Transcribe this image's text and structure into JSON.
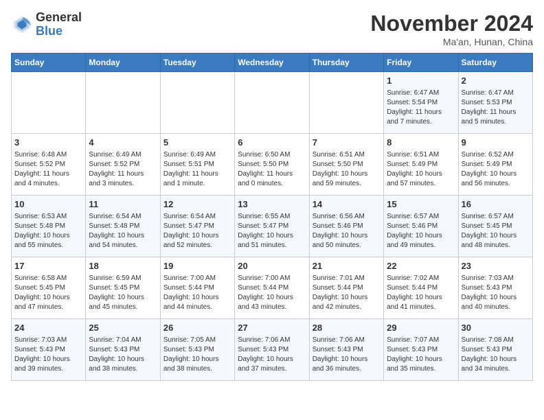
{
  "header": {
    "logo": {
      "line1": "General",
      "line2": "Blue"
    },
    "title": "November 2024",
    "location": "Ma'an, Hunan, China"
  },
  "days_of_week": [
    "Sunday",
    "Monday",
    "Tuesday",
    "Wednesday",
    "Thursday",
    "Friday",
    "Saturday"
  ],
  "weeks": [
    [
      {
        "day": "",
        "info": ""
      },
      {
        "day": "",
        "info": ""
      },
      {
        "day": "",
        "info": ""
      },
      {
        "day": "",
        "info": ""
      },
      {
        "day": "",
        "info": ""
      },
      {
        "day": "1",
        "info": "Sunrise: 6:47 AM\nSunset: 5:54 PM\nDaylight: 11 hours\nand 7 minutes."
      },
      {
        "day": "2",
        "info": "Sunrise: 6:47 AM\nSunset: 5:53 PM\nDaylight: 11 hours\nand 5 minutes."
      }
    ],
    [
      {
        "day": "3",
        "info": "Sunrise: 6:48 AM\nSunset: 5:52 PM\nDaylight: 11 hours\nand 4 minutes."
      },
      {
        "day": "4",
        "info": "Sunrise: 6:49 AM\nSunset: 5:52 PM\nDaylight: 11 hours\nand 3 minutes."
      },
      {
        "day": "5",
        "info": "Sunrise: 6:49 AM\nSunset: 5:51 PM\nDaylight: 11 hours\nand 1 minute."
      },
      {
        "day": "6",
        "info": "Sunrise: 6:50 AM\nSunset: 5:50 PM\nDaylight: 11 hours\nand 0 minutes."
      },
      {
        "day": "7",
        "info": "Sunrise: 6:51 AM\nSunset: 5:50 PM\nDaylight: 10 hours\nand 59 minutes."
      },
      {
        "day": "8",
        "info": "Sunrise: 6:51 AM\nSunset: 5:49 PM\nDaylight: 10 hours\nand 57 minutes."
      },
      {
        "day": "9",
        "info": "Sunrise: 6:52 AM\nSunset: 5:49 PM\nDaylight: 10 hours\nand 56 minutes."
      }
    ],
    [
      {
        "day": "10",
        "info": "Sunrise: 6:53 AM\nSunset: 5:48 PM\nDaylight: 10 hours\nand 55 minutes."
      },
      {
        "day": "11",
        "info": "Sunrise: 6:54 AM\nSunset: 5:48 PM\nDaylight: 10 hours\nand 54 minutes."
      },
      {
        "day": "12",
        "info": "Sunrise: 6:54 AM\nSunset: 5:47 PM\nDaylight: 10 hours\nand 52 minutes."
      },
      {
        "day": "13",
        "info": "Sunrise: 6:55 AM\nSunset: 5:47 PM\nDaylight: 10 hours\nand 51 minutes."
      },
      {
        "day": "14",
        "info": "Sunrise: 6:56 AM\nSunset: 5:46 PM\nDaylight: 10 hours\nand 50 minutes."
      },
      {
        "day": "15",
        "info": "Sunrise: 6:57 AM\nSunset: 5:46 PM\nDaylight: 10 hours\nand 49 minutes."
      },
      {
        "day": "16",
        "info": "Sunrise: 6:57 AM\nSunset: 5:45 PM\nDaylight: 10 hours\nand 48 minutes."
      }
    ],
    [
      {
        "day": "17",
        "info": "Sunrise: 6:58 AM\nSunset: 5:45 PM\nDaylight: 10 hours\nand 47 minutes."
      },
      {
        "day": "18",
        "info": "Sunrise: 6:59 AM\nSunset: 5:45 PM\nDaylight: 10 hours\nand 45 minutes."
      },
      {
        "day": "19",
        "info": "Sunrise: 7:00 AM\nSunset: 5:44 PM\nDaylight: 10 hours\nand 44 minutes."
      },
      {
        "day": "20",
        "info": "Sunrise: 7:00 AM\nSunset: 5:44 PM\nDaylight: 10 hours\nand 43 minutes."
      },
      {
        "day": "21",
        "info": "Sunrise: 7:01 AM\nSunset: 5:44 PM\nDaylight: 10 hours\nand 42 minutes."
      },
      {
        "day": "22",
        "info": "Sunrise: 7:02 AM\nSunset: 5:44 PM\nDaylight: 10 hours\nand 41 minutes."
      },
      {
        "day": "23",
        "info": "Sunrise: 7:03 AM\nSunset: 5:43 PM\nDaylight: 10 hours\nand 40 minutes."
      }
    ],
    [
      {
        "day": "24",
        "info": "Sunrise: 7:03 AM\nSunset: 5:43 PM\nDaylight: 10 hours\nand 39 minutes."
      },
      {
        "day": "25",
        "info": "Sunrise: 7:04 AM\nSunset: 5:43 PM\nDaylight: 10 hours\nand 38 minutes."
      },
      {
        "day": "26",
        "info": "Sunrise: 7:05 AM\nSunset: 5:43 PM\nDaylight: 10 hours\nand 38 minutes."
      },
      {
        "day": "27",
        "info": "Sunrise: 7:06 AM\nSunset: 5:43 PM\nDaylight: 10 hours\nand 37 minutes."
      },
      {
        "day": "28",
        "info": "Sunrise: 7:06 AM\nSunset: 5:43 PM\nDaylight: 10 hours\nand 36 minutes."
      },
      {
        "day": "29",
        "info": "Sunrise: 7:07 AM\nSunset: 5:43 PM\nDaylight: 10 hours\nand 35 minutes."
      },
      {
        "day": "30",
        "info": "Sunrise: 7:08 AM\nSunset: 5:43 PM\nDaylight: 10 hours\nand 34 minutes."
      }
    ]
  ]
}
